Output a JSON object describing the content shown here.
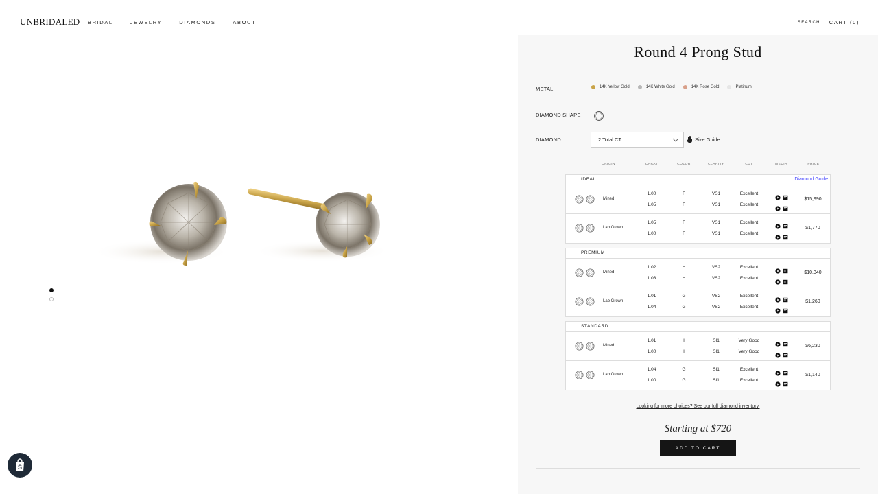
{
  "header": {
    "logo": "UNBRIDALED",
    "nav": [
      "BRIDAL",
      "JEWELRY",
      "DIAMONDS",
      "ABOUT"
    ],
    "search": "SEARCH",
    "cart": "CART (0)"
  },
  "product": {
    "title": "Round 4 Prong Stud",
    "metal_label": "METAL",
    "metals": [
      {
        "name": "14K Yellow Gold",
        "color": "#c9a449"
      },
      {
        "name": "14K White Gold",
        "color": "#b8b8b8"
      },
      {
        "name": "14K Rose Gold",
        "color": "#d8a08a"
      },
      {
        "name": "Platinum",
        "color": "#e6e6e6"
      }
    ],
    "shape_label": "DIAMOND SHAPE",
    "diamond_label": "DIAMOND",
    "diamond_select": "2 Total CT",
    "size_guide": "Size Guide",
    "columns": [
      "ORIGIN",
      "CARAT",
      "COLOR",
      "CLARITY",
      "CUT",
      "MEDIA",
      "PRICE"
    ],
    "diamond_guide": "Diamond Guide",
    "groups": [
      {
        "name": "IDEAL",
        "rows": [
          {
            "origin": "Mined",
            "carat": [
              "1.00",
              "1.05"
            ],
            "color": [
              "F",
              "F"
            ],
            "clarity": [
              "VS1",
              "VS1"
            ],
            "cut": [
              "Excellent",
              "Excellent"
            ],
            "price": "$15,990"
          },
          {
            "origin": "Lab Grown",
            "carat": [
              "1.05",
              "1.00"
            ],
            "color": [
              "F",
              "F"
            ],
            "clarity": [
              "VS1",
              "VS1"
            ],
            "cut": [
              "Excellent",
              "Excellent"
            ],
            "price": "$1,770"
          }
        ]
      },
      {
        "name": "PREMIUM",
        "rows": [
          {
            "origin": "Mined",
            "carat": [
              "1.02",
              "1.03"
            ],
            "color": [
              "H",
              "H"
            ],
            "clarity": [
              "VS2",
              "VS2"
            ],
            "cut": [
              "Excellent",
              "Excellent"
            ],
            "price": "$10,340"
          },
          {
            "origin": "Lab Grown",
            "carat": [
              "1.01",
              "1.04"
            ],
            "color": [
              "G",
              "G"
            ],
            "clarity": [
              "VS2",
              "VS2"
            ],
            "cut": [
              "Excellent",
              "Excellent"
            ],
            "price": "$1,260"
          }
        ]
      },
      {
        "name": "STANDARD",
        "rows": [
          {
            "origin": "Mined",
            "carat": [
              "1.01",
              "1.00"
            ],
            "color": [
              "I",
              "I"
            ],
            "clarity": [
              "SI1",
              "SI1"
            ],
            "cut": [
              "Very Good",
              "Very Good"
            ],
            "price": "$6,230"
          },
          {
            "origin": "Lab Grown",
            "carat": [
              "1.04",
              "1.00"
            ],
            "color": [
              "G",
              "G"
            ],
            "clarity": [
              "SI1",
              "SI1"
            ],
            "cut": [
              "Excellent",
              "Excellent"
            ],
            "price": "$1,140"
          }
        ]
      }
    ],
    "more_link": "Looking for more choices? See our full diamond inventory.",
    "starting_at": "Starting at $720",
    "add_to_cart": "ADD TO CART"
  },
  "accent_colors": {
    "gold": "#c9a449",
    "link": "#4a4aff",
    "button": "#151515"
  }
}
